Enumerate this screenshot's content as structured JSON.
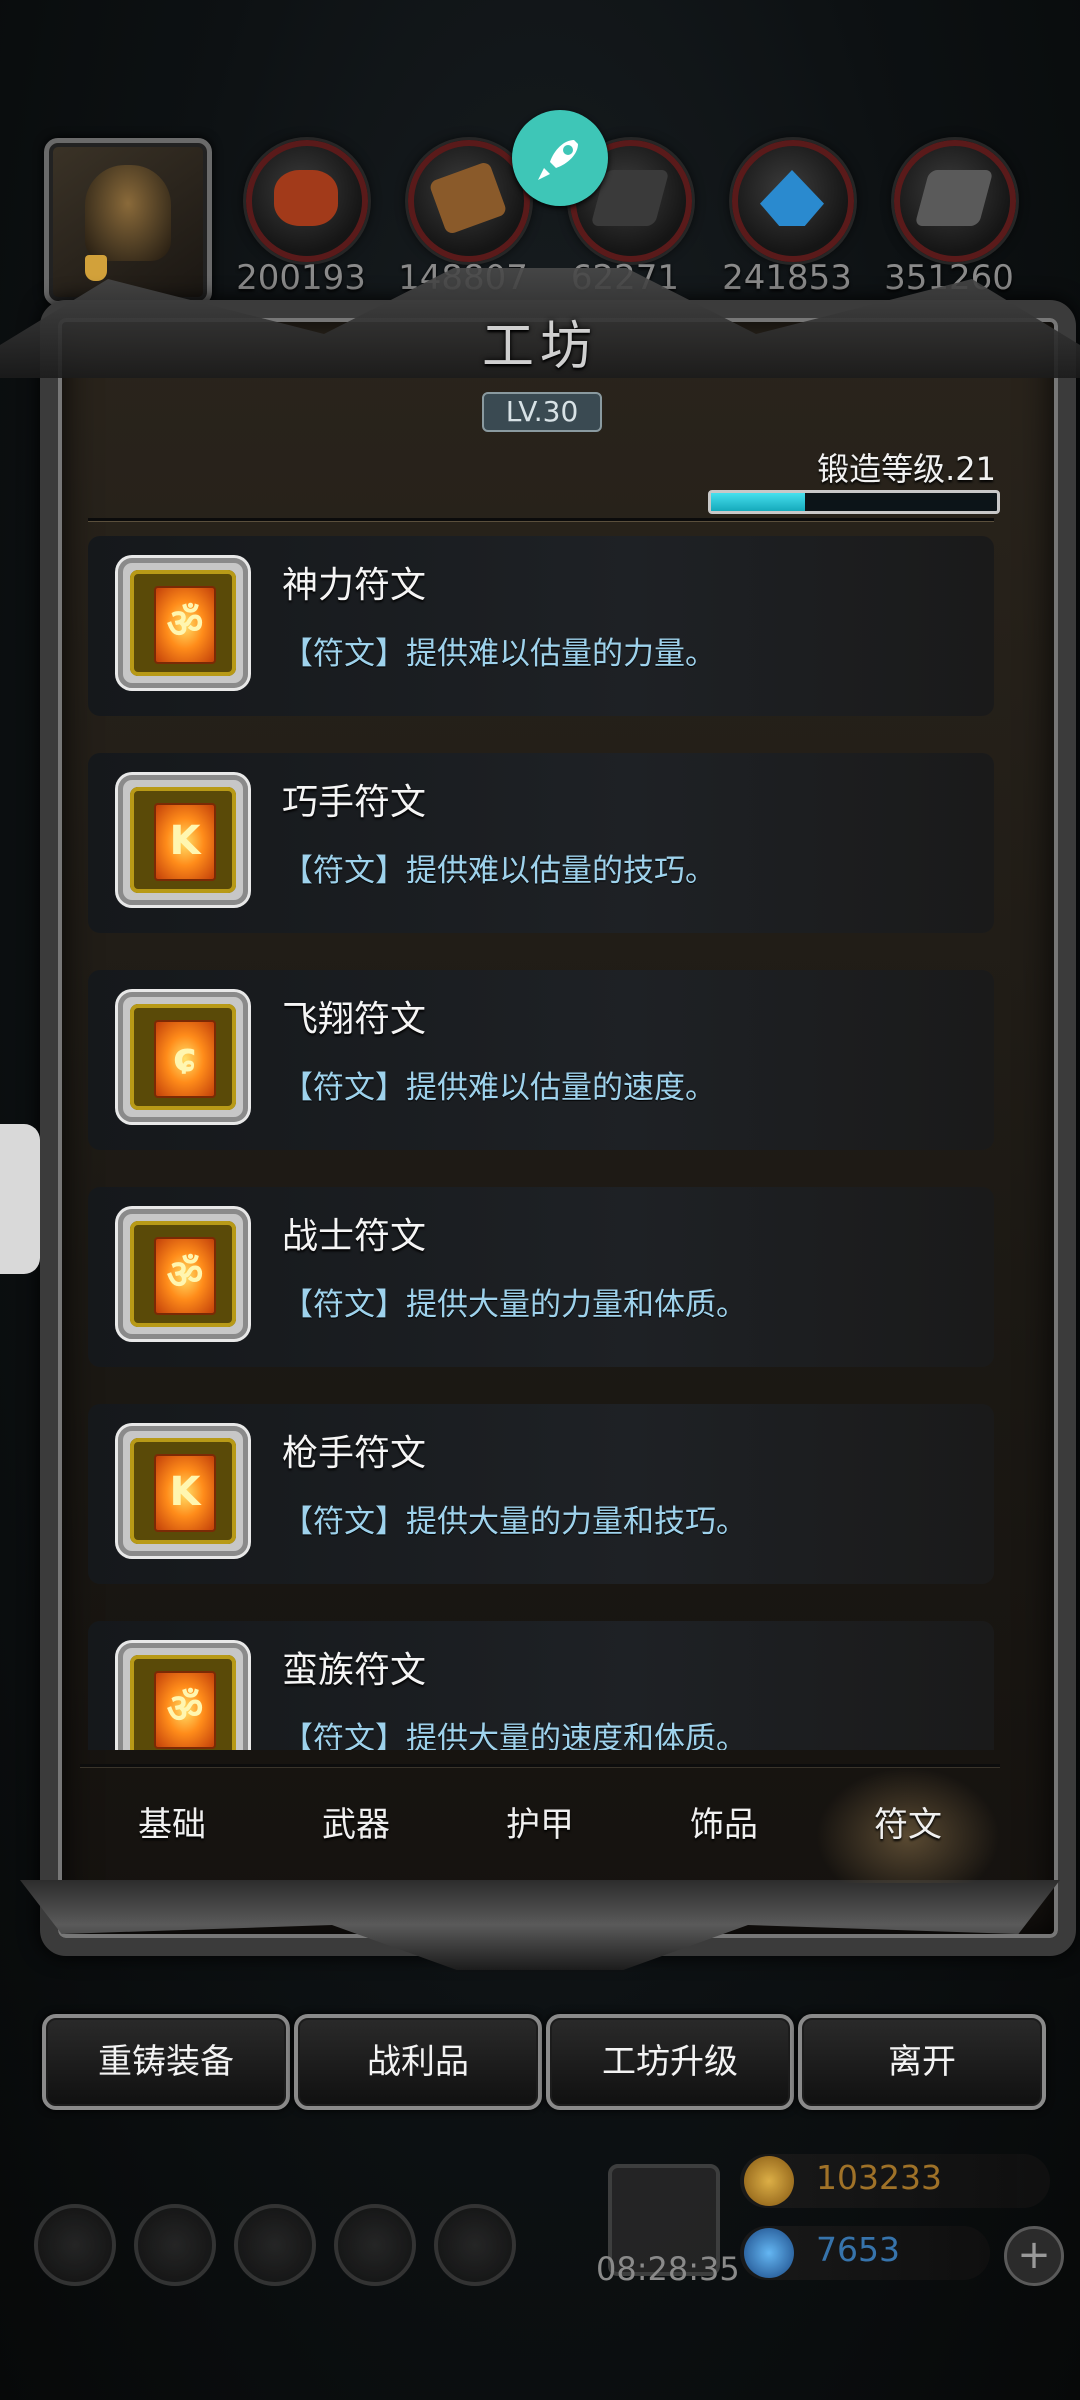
{
  "resources": [
    {
      "icon": "meat-icon",
      "count": "200193",
      "color": "#a23a1a"
    },
    {
      "icon": "wood-icon",
      "count": "148807",
      "color": "#8a5a2a"
    },
    {
      "icon": "iron-icon",
      "count": "62271",
      "color": "#4a4a4a"
    },
    {
      "icon": "crystal-icon",
      "count": "241853",
      "color": "#2a8acf"
    },
    {
      "icon": "steel-icon",
      "count": "351260",
      "color": "#5a5a5a"
    }
  ],
  "workshop": {
    "title": "工坊",
    "level": "LV.30",
    "forge_label": "锻造等级.21",
    "forge_progress": 0.33
  },
  "runes": [
    {
      "name": "神力符文",
      "desc": "【符文】提供难以估量的力量。",
      "glyph": "ॐ"
    },
    {
      "name": "巧手符文",
      "desc": "【符文】提供难以估量的技巧。",
      "glyph": "K"
    },
    {
      "name": "飞翔符文",
      "desc": "【符文】提供难以估量的速度。",
      "glyph": "ɕ"
    },
    {
      "name": "战士符文",
      "desc": "【符文】提供大量的力量和体质。",
      "glyph": "ॐ"
    },
    {
      "name": "枪手符文",
      "desc": "【符文】提供大量的力量和技巧。",
      "glyph": "K"
    },
    {
      "name": "蛮族符文",
      "desc": "【符文】提供大量的速度和体质。",
      "glyph": "ॐ"
    }
  ],
  "tabs": [
    "基础",
    "武器",
    "护甲",
    "饰品",
    "符文"
  ],
  "active_tab": "符文",
  "actions": [
    "重铸装备",
    "战利品",
    "工坊升级",
    "离开"
  ],
  "hud": {
    "timer": "08:28:35",
    "gold": "103233",
    "gems": "7653",
    "plus": "+"
  },
  "colors": {
    "accent_teal": "#3ec6b7",
    "desc_blue": "#9ed2ec",
    "gold_text": "#a8782a",
    "gem_text": "#3a7ab5"
  }
}
